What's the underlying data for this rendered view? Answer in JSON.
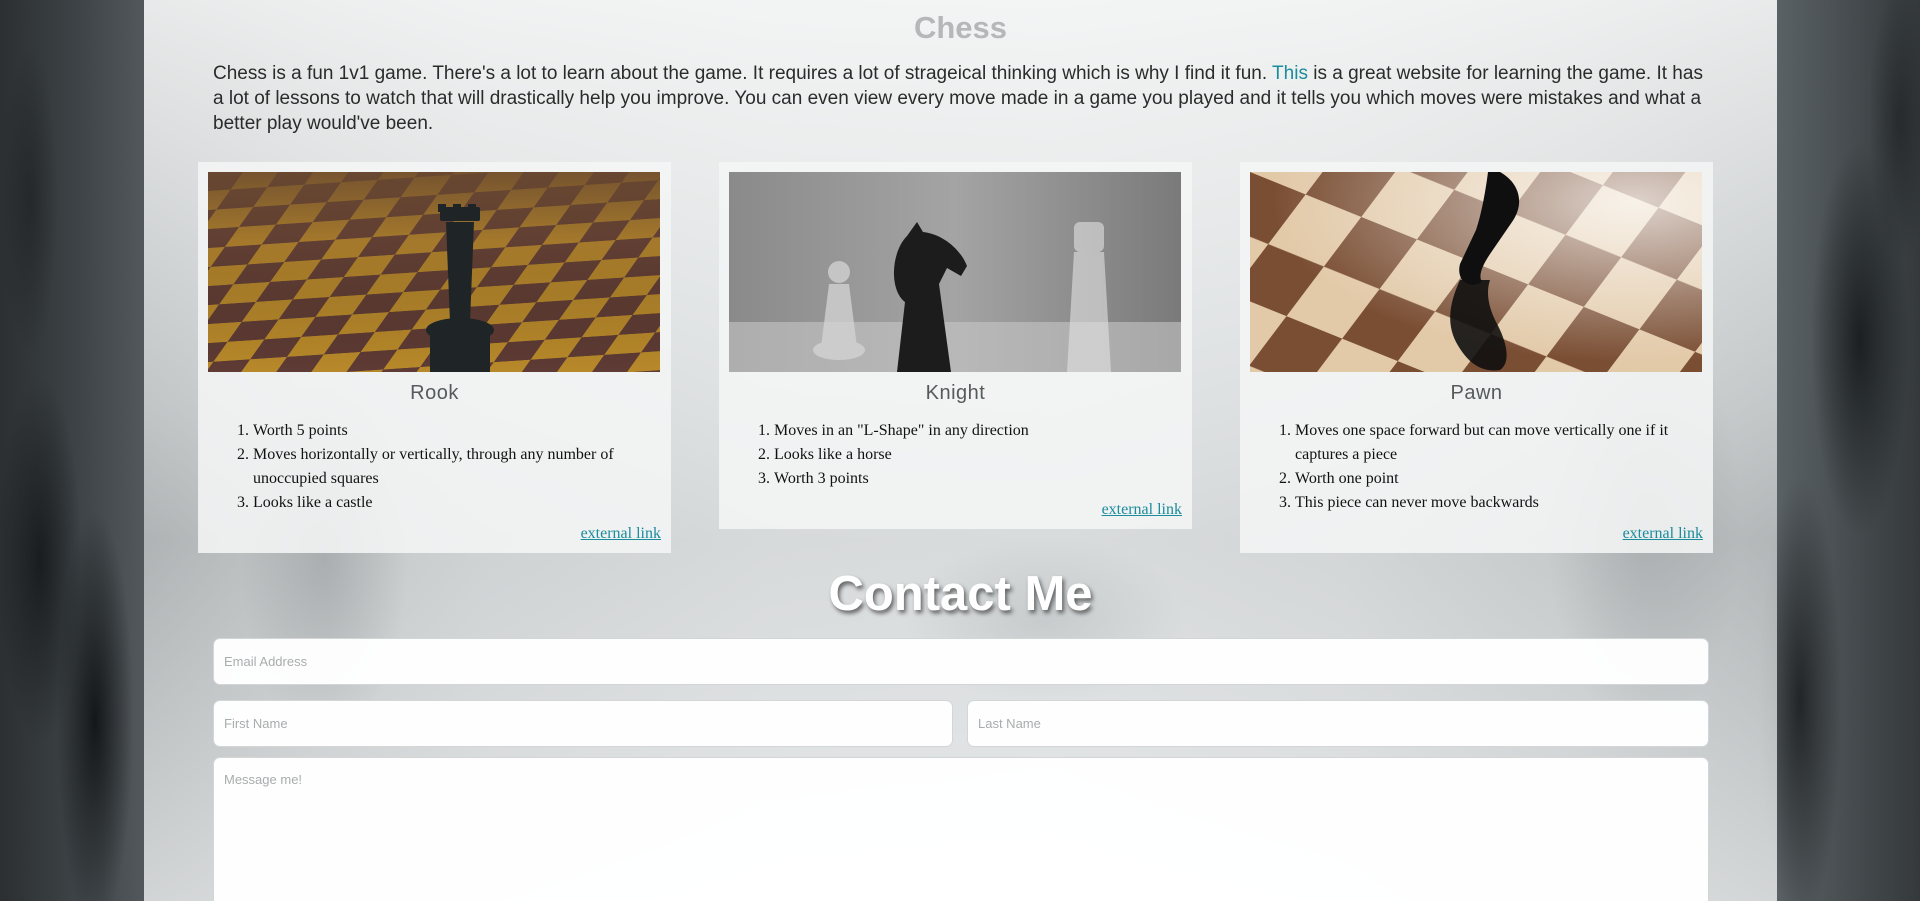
{
  "page": {
    "title": "Chess",
    "intro_before_link": "Chess is a fun 1v1 game. There's a lot to learn about the game. It requires a lot of strageical thinking which is why I find it fun. ",
    "intro_link": "This",
    "intro_after_link": " is a great website for learning the game. It has a lot of lessons to watch that will drastically help you improve. You can even view every move made in a game you played and it tells you which moves were mistakes and what a better play would've been."
  },
  "cards": [
    {
      "title": "Rook",
      "items": [
        "Worth 5 points",
        "Moves horizontally or vertically, through any number of unoccupied squares",
        "Looks like a castle"
      ],
      "link": "external link"
    },
    {
      "title": "Knight",
      "items": [
        "Moves in an \"L-Shape\" in any direction",
        "Looks like a horse",
        "Worth 3 points"
      ],
      "link": "external link"
    },
    {
      "title": "Pawn",
      "items": [
        "Moves one space forward but can move vertically one if it captures a piece",
        "Worth one point",
        "This piece can never move backwards"
      ],
      "link": "external link"
    }
  ],
  "contact": {
    "title": "Contact Me",
    "email_placeholder": "Email Address",
    "first_name_placeholder": "First Name",
    "last_name_placeholder": "Last Name",
    "message_placeholder": "Message me!"
  },
  "colors": {
    "link": "#1a8c9c",
    "title_gray": "#b5b7b8"
  }
}
